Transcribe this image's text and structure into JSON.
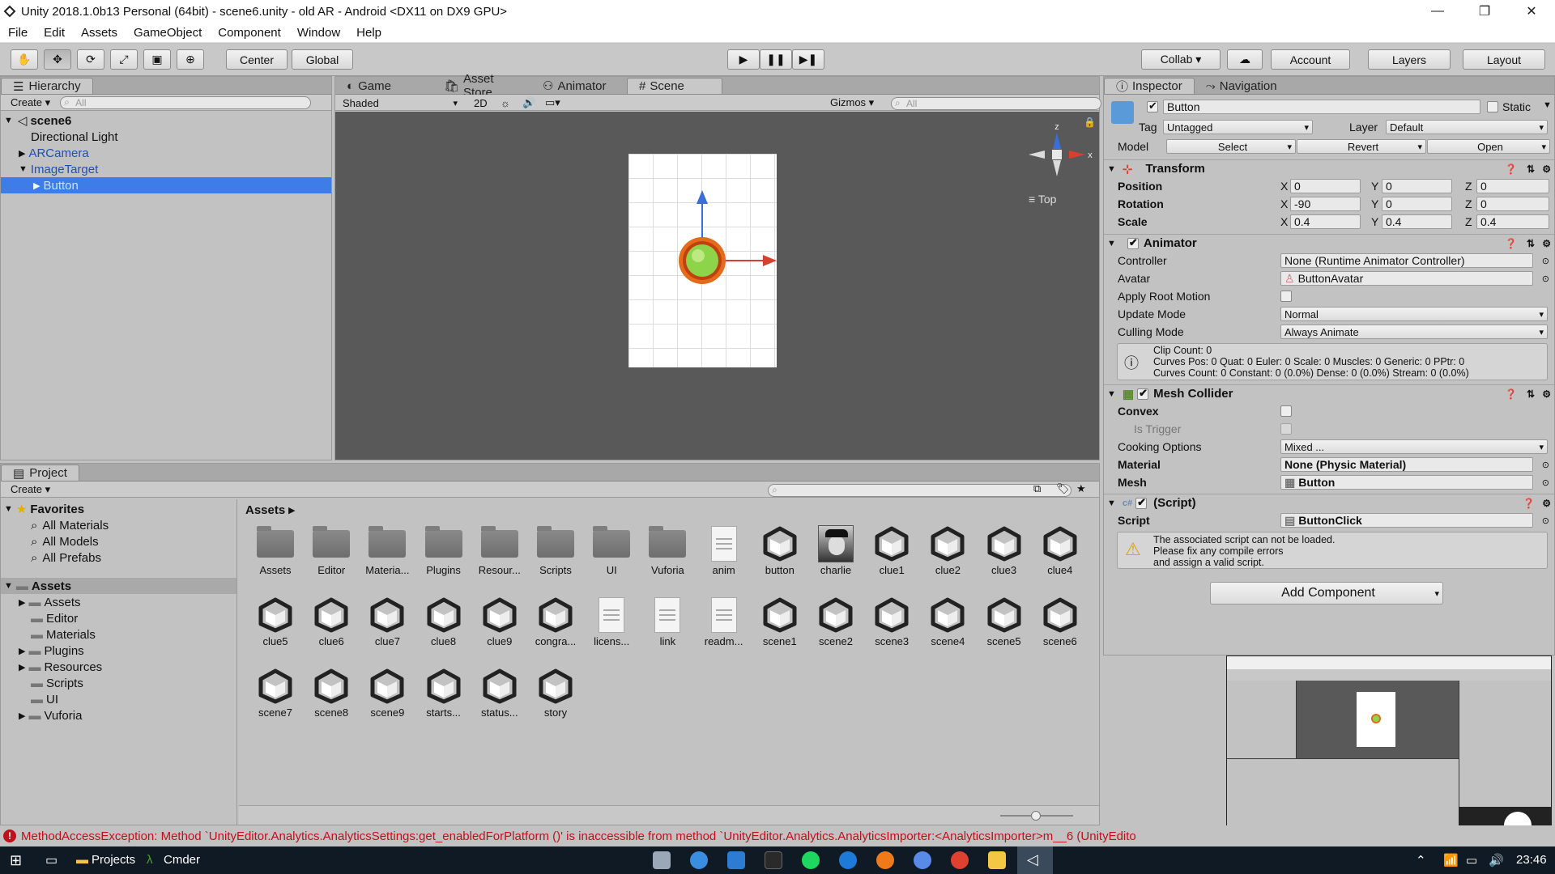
{
  "window": {
    "title": "Unity 2018.1.0b13 Personal (64bit) - scene6.unity - old AR - Android <DX11 on DX9 GPU>",
    "controls": [
      "—",
      "❐",
      "✕"
    ]
  },
  "menu": [
    "File",
    "Edit",
    "Assets",
    "GameObject",
    "Component",
    "Window",
    "Help"
  ],
  "toolbar": {
    "pivot": "Center",
    "space": "Global",
    "collab": "Collab ▾",
    "account": "Account",
    "layers": "Layers",
    "layout": "Layout"
  },
  "hierarchy": {
    "tab": "Hierarchy",
    "create": "Create ▾",
    "search_placeholder": "All",
    "scene": "scene6",
    "items": [
      "Directional Light",
      "ARCamera",
      "ImageTarget",
      "Button"
    ]
  },
  "scene_tabs": {
    "game": "Game",
    "asset_store": "Asset Store",
    "animator": "Animator",
    "scene": "Scene"
  },
  "scene_bar": {
    "shading": "Shaded",
    "mode_2d": "2D",
    "gizmos": "Gizmos ▾",
    "search_placeholder": "All",
    "gizmo_label": "Top",
    "axes": {
      "x": "x",
      "z": "z"
    }
  },
  "project": {
    "tab": "Project",
    "create": "Create ▾",
    "breadcrumb": "Assets ▸",
    "favorites_label": "Favorites",
    "favorites": [
      "All Materials",
      "All Models",
      "All Prefabs"
    ],
    "assets_label": "Assets",
    "folders": [
      "Assets",
      "Editor",
      "Materials",
      "Plugins",
      "Resources",
      "Scripts",
      "UI",
      "Vuforia"
    ],
    "items_row1": [
      "Assets",
      "Editor",
      "Materia...",
      "Plugins",
      "Resour...",
      "Scripts",
      "UI",
      "Vuforia",
      "anim",
      "button",
      "charlie",
      "clue1",
      "clue2",
      "clue3",
      "clue4"
    ],
    "items_row2": [
      "clue5",
      "clue6",
      "clue7",
      "clue8",
      "clue9",
      "congra...",
      "licens...",
      "link",
      "readm...",
      "scene1",
      "scene2",
      "scene3",
      "scene4",
      "scene5",
      "scene6"
    ],
    "items_row3": [
      "scene7",
      "scene8",
      "scene9",
      "starts...",
      "status...",
      "story"
    ]
  },
  "inspector": {
    "tab": "Inspector",
    "nav_tab": "Navigation",
    "object_name": "Button",
    "static_label": "Static",
    "tag_label": "Tag",
    "tag_value": "Untagged",
    "layer_label": "Layer",
    "layer_value": "Default",
    "model_label": "Model",
    "model_buttons": [
      "Select",
      "Revert",
      "Open"
    ],
    "transform": {
      "title": "Transform",
      "position": {
        "label": "Position",
        "x": "0",
        "y": "0",
        "z": "0"
      },
      "rotation": {
        "label": "Rotation",
        "x": "-90",
        "y": "0",
        "z": "0"
      },
      "scale": {
        "label": "Scale",
        "x": "0.4",
        "y": "0.4",
        "z": "0.4"
      }
    },
    "animator": {
      "title": "Animator",
      "controller_label": "Controller",
      "controller_value": "None (Runtime Animator Controller)",
      "avatar_label": "Avatar",
      "avatar_value": "ButtonAvatar",
      "root_motion_label": "Apply Root Motion",
      "update_label": "Update Mode",
      "update_value": "Normal",
      "culling_label": "Culling Mode",
      "culling_value": "Always Animate",
      "info_line1": "Clip Count: 0",
      "info_line2": "Curves Pos: 0 Quat: 0 Euler: 0 Scale: 0 Muscles: 0 Generic: 0 PPtr: 0",
      "info_line3": "Curves Count: 0 Constant: 0 (0.0%) Dense: 0 (0.0%) Stream: 0 (0.0%)"
    },
    "mesh_collider": {
      "title": "Mesh Collider",
      "convex_label": "Convex",
      "trigger_label": "Is Trigger",
      "cooking_label": "Cooking Options",
      "cooking_value": "Mixed ...",
      "material_label": "Material",
      "material_value": "None (Physic Material)",
      "mesh_label": "Mesh",
      "mesh_value": "Button"
    },
    "script": {
      "title": "(Script)",
      "label": "Script",
      "value": "ButtonClick",
      "warning_line1": "The associated script can not be loaded.",
      "warning_line2": "Please fix any compile errors",
      "warning_line3": "and assign a valid script."
    },
    "add_component": "Add Component"
  },
  "status": {
    "error": "MethodAccessException: Method `UnityEditor.Analytics.AnalyticsSettings:get_enabledForPlatform ()' is inaccessible from method `UnityEditor.Analytics.AnalyticsImporter:<AnalyticsImporter>m__6 (UnityEdito"
  },
  "taskbar": {
    "projects": "Projects",
    "cmder": "Cmder",
    "clock": "23:46"
  },
  "colors": {
    "selection": "#3e7de7",
    "error_red": "#c0101a",
    "scene_bg": "#595959",
    "taskbar": "#101a24"
  }
}
